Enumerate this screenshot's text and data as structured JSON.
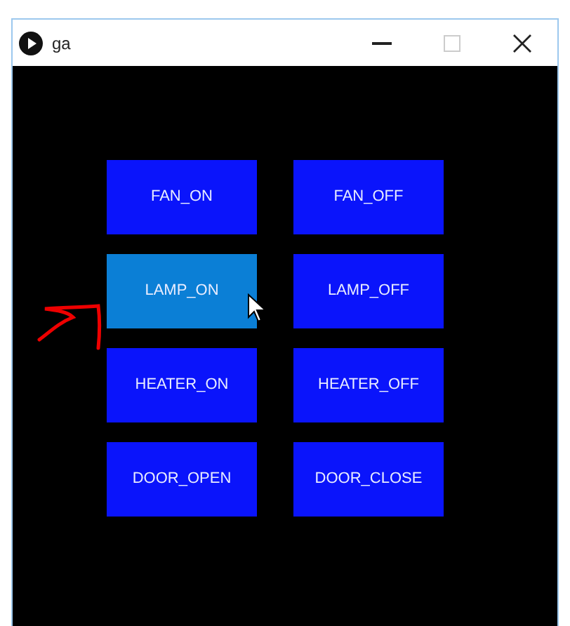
{
  "window": {
    "title": "ga",
    "maximize_disabled": true
  },
  "buttons": [
    {
      "label": "FAN_ON",
      "hovered": false
    },
    {
      "label": "FAN_OFF",
      "hovered": false
    },
    {
      "label": "LAMP_ON",
      "hovered": true
    },
    {
      "label": "LAMP_OFF",
      "hovered": false
    },
    {
      "label": "HEATER_ON",
      "hovered": false
    },
    {
      "label": "HEATER_OFF",
      "hovered": false
    },
    {
      "label": "DOOR_OPEN",
      "hovered": false
    },
    {
      "label": "DOOR_CLOSE",
      "hovered": false
    }
  ]
}
